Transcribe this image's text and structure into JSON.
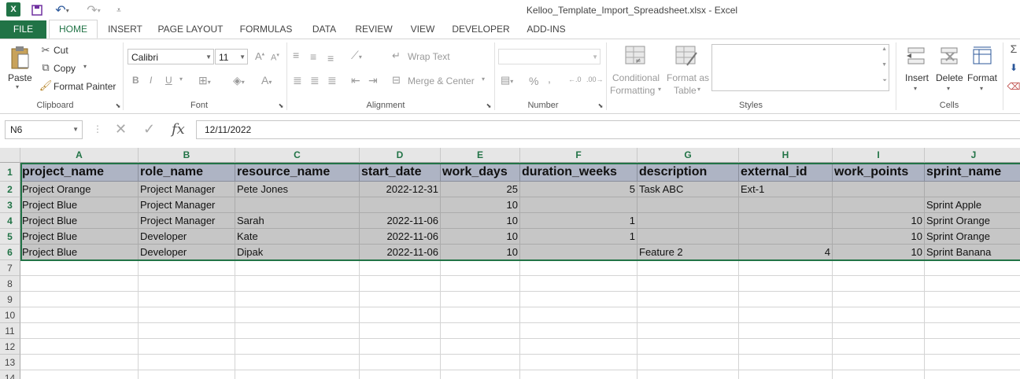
{
  "titlebar": {
    "title": "Kelloo_Template_Import_Spreadsheet.xlsx - Excel",
    "icons": [
      "excel-logo",
      "save-icon",
      "undo-icon",
      "redo-icon",
      "customize-qat-icon"
    ]
  },
  "tabs": [
    {
      "label": "FILE"
    },
    {
      "label": "HOME"
    },
    {
      "label": "INSERT"
    },
    {
      "label": "PAGE LAYOUT"
    },
    {
      "label": "FORMULAS"
    },
    {
      "label": "DATA"
    },
    {
      "label": "REVIEW"
    },
    {
      "label": "VIEW"
    },
    {
      "label": "DEVELOPER"
    },
    {
      "label": "ADD-INS"
    }
  ],
  "ribbon": {
    "clipboard": {
      "paste": "Paste",
      "cut": "Cut",
      "copy": "Copy",
      "format_painter": "Format Painter",
      "label": "Clipboard"
    },
    "font": {
      "font_name": "Calibri",
      "font_size": "11",
      "label": "Font",
      "bold": "B",
      "italic": "I",
      "underline": "U"
    },
    "alignment": {
      "wrap_text": "Wrap Text",
      "merge_center": "Merge & Center",
      "label": "Alignment"
    },
    "number": {
      "percent": "%",
      "comma": ",",
      "label": "Number"
    },
    "styles": {
      "conditional_1": "Conditional",
      "conditional_2": "Formatting",
      "format_table_1": "Format as",
      "format_table_2": "Table",
      "label": "Styles"
    },
    "cells": {
      "insert": "Insert",
      "delete": "Delete",
      "format": "Format",
      "label": "Cells"
    }
  },
  "formula_bar": {
    "name_box": "N6",
    "fx": "fx",
    "formula": "12/11/2022"
  },
  "columns": [
    "A",
    "B",
    "C",
    "D",
    "E",
    "F",
    "G",
    "H",
    "I",
    "J"
  ],
  "row_numbers": [
    "1",
    "2",
    "3",
    "4",
    "5",
    "6",
    "7",
    "8",
    "9",
    "10",
    "11",
    "12",
    "13",
    "14"
  ],
  "header_row": [
    "project_name",
    "role_name",
    "resource_name",
    "start_date",
    "work_days",
    "duration_weeks",
    "description",
    "external_id",
    "work_points",
    "sprint_name"
  ],
  "rows": [
    [
      "Project Orange",
      "Project Manager",
      "Pete Jones",
      "2022-12-31",
      "25",
      "5",
      "Task ABC",
      "Ext-1",
      "",
      ""
    ],
    [
      "Project Blue",
      "Project Manager",
      "",
      "",
      "10",
      "",
      "",
      "",
      "",
      "Sprint Apple"
    ],
    [
      "Project Blue",
      "Project Manager",
      "Sarah",
      "2022-11-06",
      "10",
      "1",
      "",
      "",
      "10",
      "Sprint Orange"
    ],
    [
      "Project Blue",
      "Developer",
      "Kate",
      "2022-11-06",
      "10",
      "1",
      "",
      "",
      "10",
      "Sprint Orange"
    ],
    [
      "Project Blue",
      "Developer",
      "Dipak",
      "2022-11-06",
      "10",
      "",
      "Feature 2",
      "4",
      "10",
      "Sprint Banana"
    ]
  ]
}
